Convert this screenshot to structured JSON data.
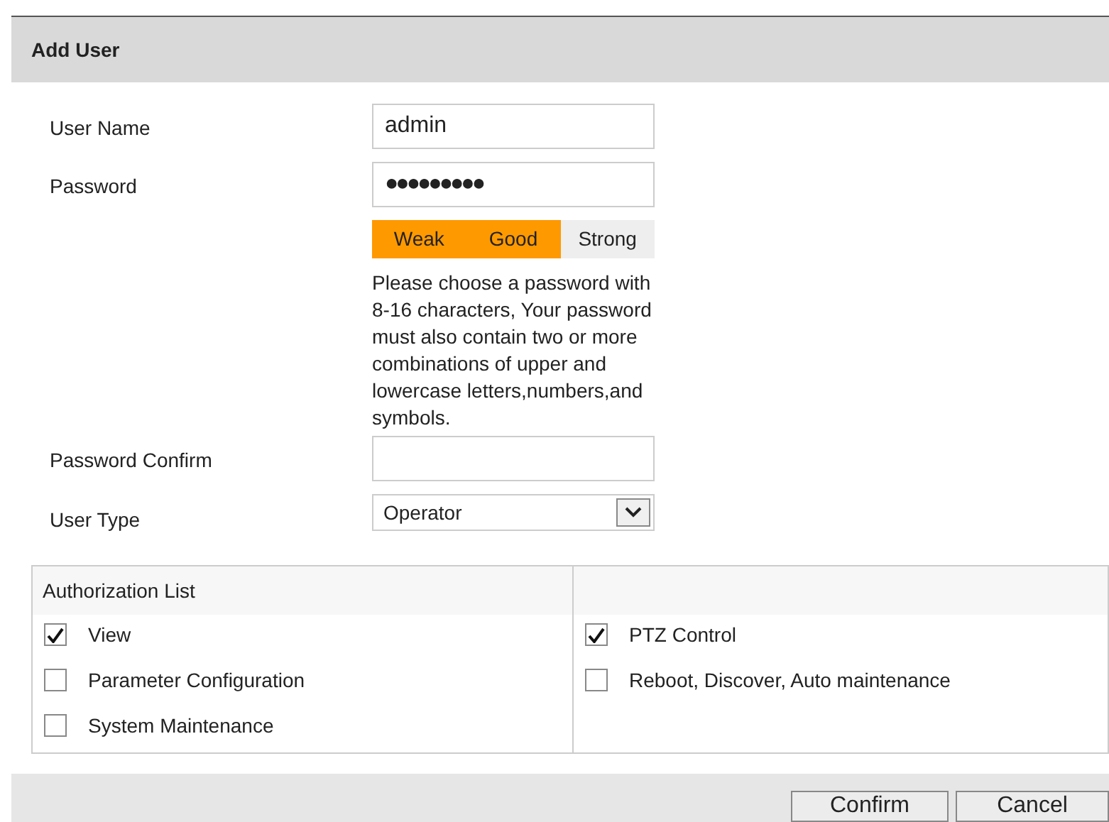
{
  "dialog": {
    "title": "Add User"
  },
  "fields": [
    {
      "kind": "text",
      "label": "User Name",
      "value": "admin"
    },
    {
      "kind": "password",
      "label": "Password",
      "value": "●●●●●●●●●"
    },
    {
      "kind": "strength",
      "segments": [
        {
          "label": "Weak",
          "on": true
        },
        {
          "label": "Good",
          "on": true
        },
        {
          "label": "Strong",
          "on": false
        }
      ],
      "hint": "Please choose a password with 8-16 characters, Your password must also contain two or more combinations of upper and lowercase letters,numbers,and symbols."
    },
    {
      "kind": "text",
      "label": "Password Confirm"
    },
    {
      "kind": "select",
      "label": "User Type",
      "value": "Operator"
    }
  ],
  "authorization": {
    "title": "Authorization List",
    "left": [
      {
        "label": "View",
        "checked": true
      },
      {
        "label": "Parameter Configuration",
        "checked": false
      },
      {
        "label": "System Maintenance",
        "checked": false
      }
    ],
    "right": [
      {
        "label": "PTZ Control",
        "checked": true
      },
      {
        "label": "Reboot, Discover, Auto maintenance",
        "checked": false
      }
    ]
  },
  "buttons": [
    "Confirm",
    "Cancel"
  ]
}
